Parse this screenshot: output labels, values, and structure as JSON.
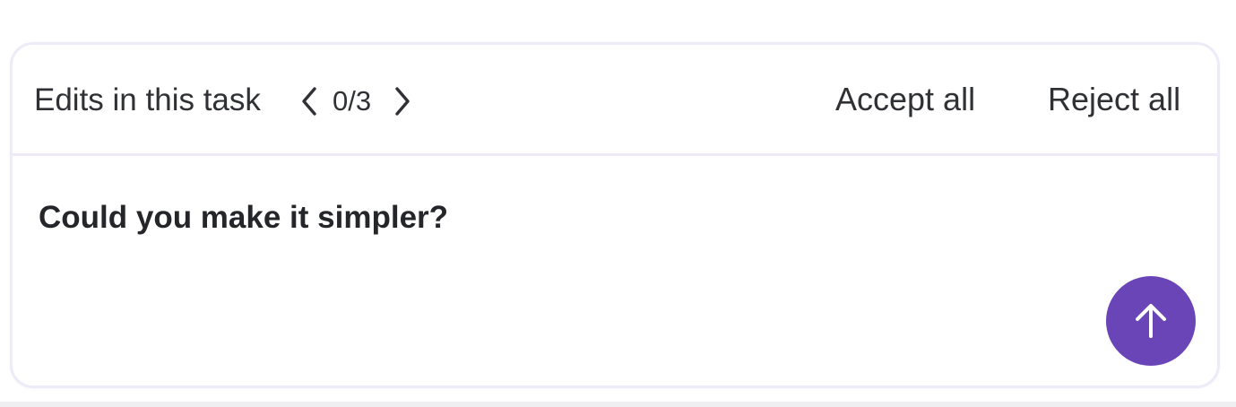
{
  "edits_bar": {
    "title": "Edits in this task",
    "counter": "0/3",
    "prev_icon": "chevron-left-icon",
    "next_icon": "chevron-right-icon",
    "accept_label": "Accept all",
    "reject_label": "Reject all"
  },
  "prompt": {
    "text": "Could you make it simpler?",
    "send_icon": "arrow-up-icon"
  },
  "colors": {
    "accent": "#6a45b8",
    "border": "#eeeaf8",
    "text": "#2f3135"
  }
}
